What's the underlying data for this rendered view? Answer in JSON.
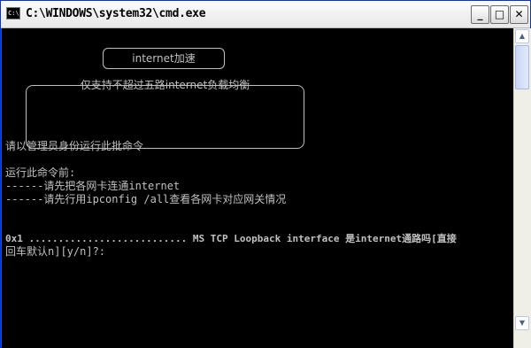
{
  "window": {
    "title": "C:\\WINDOWS\\system32\\cmd.exe",
    "icon_label": "C:\\",
    "buttons": {
      "minimize": "_",
      "maximize": "□",
      "close": "✕"
    }
  },
  "banner": {
    "title": "internet加速",
    "body": "仅支持不超过五路internet负载均衡"
  },
  "console": {
    "line1": "请以管理员身份运行此批命令",
    "line2": "运行此命令前:",
    "line3": "------请先把各网卡连通internet",
    "line4": "------请先行用ipconfig /all查看各网卡对应网关情况",
    "prompt1": "0x1 ........................... MS TCP Loopback interface 是internet通路吗[直接",
    "prompt2": "回车默认n][y/n]?:"
  },
  "scrollbar": {
    "up": "▲",
    "down": "▼"
  }
}
